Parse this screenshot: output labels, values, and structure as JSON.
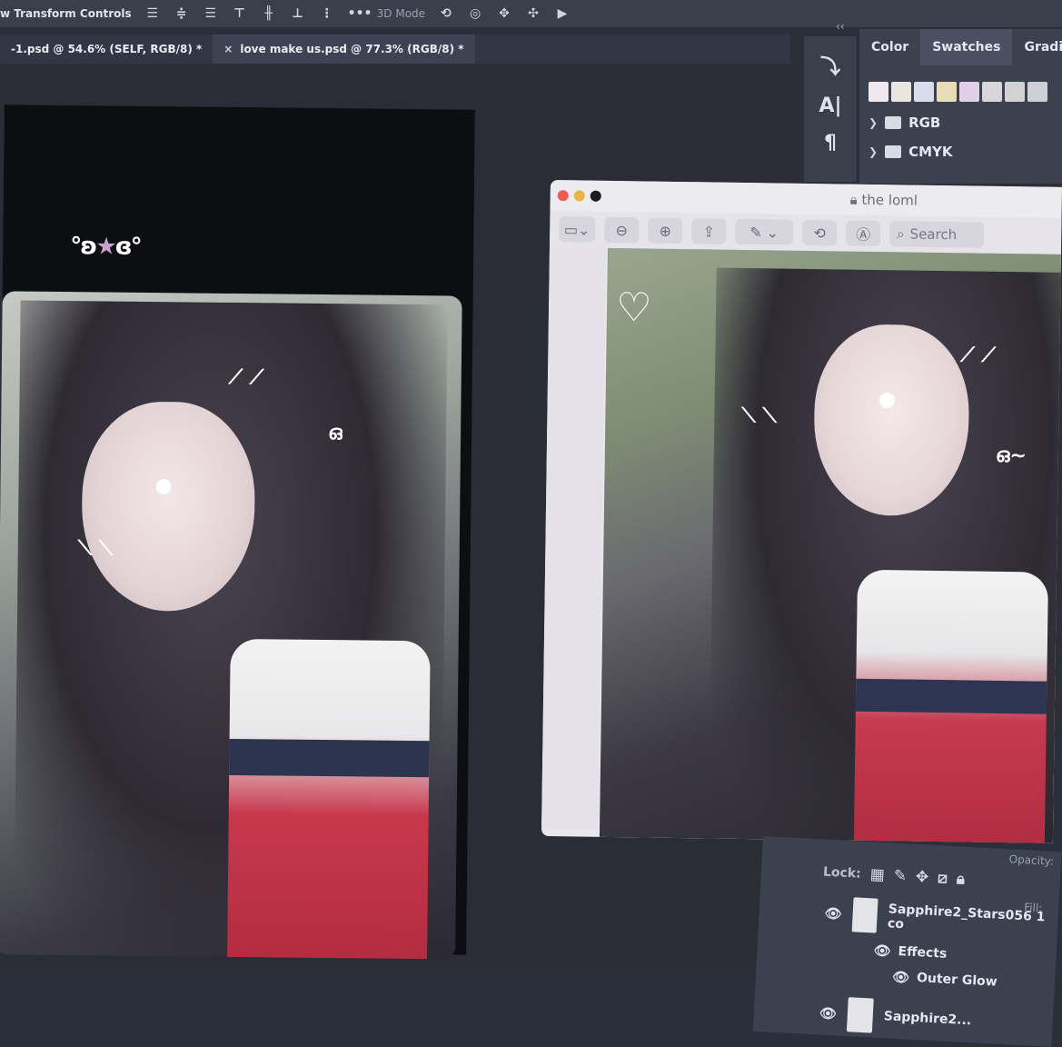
{
  "optbar": {
    "transform_label": "w Transform Controls",
    "mode_label": "3D Mode",
    "more": "•••"
  },
  "tabs": [
    {
      "label": "-1.psd @ 54.6% (SELF, RGB/8) *"
    },
    {
      "close": "×",
      "label": "love make us.psd @ 77.3% (RGB/8) *"
    }
  ],
  "artboard": {
    "sticker_left": "°ʚ",
    "sticker_star": "★",
    "sticker_right": "ɞ°"
  },
  "right_panel": {
    "collapse": "‹‹",
    "tabs": [
      "Color",
      "Swatches",
      "Gradi"
    ],
    "active_tab": "Swatches",
    "swatch_colors": [
      "#efe9ef",
      "#ebe5e0",
      "#d9dced",
      "#e8dcb7",
      "#e1cfe7",
      "#d8d6db",
      "#d2d1d4",
      "#cfd0d5"
    ],
    "folders": [
      {
        "label": "RGB"
      },
      {
        "label": "CMYK"
      }
    ]
  },
  "preview": {
    "title": "the loml",
    "search": "Search",
    "lights": [
      "#ee5b57",
      "#e6b642",
      "#1b1b1b"
    ]
  },
  "layers": {
    "opacity": "Opacity:",
    "lock": "Lock:",
    "fill": "Fill:",
    "rows": [
      {
        "name": "Sapphire2_Stars056 1 co"
      },
      {
        "name": "Sapphire2..."
      }
    ],
    "effects": "Effects",
    "outer_glow": "Outer Glow"
  }
}
